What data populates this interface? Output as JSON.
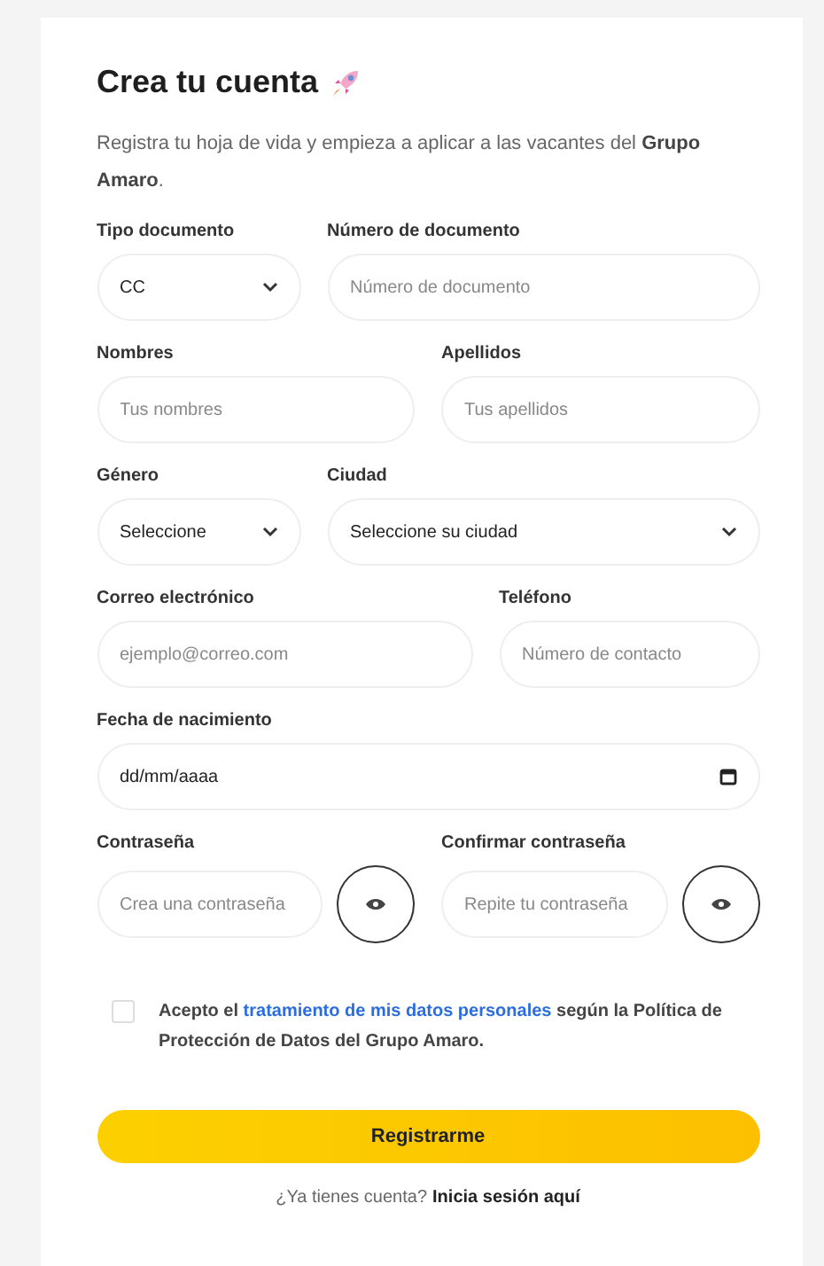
{
  "title": "Crea tu cuenta",
  "intro": "Registra tu hoja de vida y empieza a aplicar a las vacantes del **Grupo Amaro**.",
  "rows": [
    {
      "fields": [
        {
          "kind": "select",
          "label": "Tipo documento",
          "value": "CC"
        },
        {
          "kind": "input",
          "label": "Número de documento",
          "placeholder": "Número de documento"
        }
      ]
    },
    {
      "fields": [
        {
          "kind": "input",
          "label": "Nombres",
          "placeholder": "Tus nombres"
        },
        {
          "kind": "input",
          "label": "Apellidos",
          "placeholder": "Tus apellidos"
        }
      ]
    },
    {
      "fields": [
        {
          "kind": "select",
          "label": "Género",
          "value": "Seleccione"
        },
        {
          "kind": "select",
          "label": "Ciudad",
          "value": "Seleccione su ciudad"
        }
      ]
    },
    {
      "fields": [
        {
          "kind": "input",
          "label": "Correo electrónico",
          "placeholder": "ejemplo@correo.com"
        },
        {
          "kind": "input",
          "label": "Teléfono",
          "placeholder": "Número de contacto"
        }
      ]
    },
    {
      "fields": [
        {
          "kind": "date",
          "label": "Fecha de nacimiento",
          "value": "dd/mm/aaaa"
        }
      ]
    },
    {
      "fields": [
        {
          "kind": "password",
          "label": "Contraseña",
          "placeholder": "Crea una contraseña"
        },
        {
          "kind": "password",
          "label": "Confirmar contraseña",
          "placeholder": "Repite tu contraseña"
        }
      ]
    }
  ],
  "consent": {
    "checked": false,
    "before": "Acepto el ",
    "link": "tratamiento de mis datos personales",
    "after": " según la Política de Protección de Datos del Grupo Amaro."
  },
  "submit": "Registrarme",
  "footer": {
    "prompt": "¿Ya tienes cuenta?",
    "link": "Inicia sesión aquí"
  }
}
